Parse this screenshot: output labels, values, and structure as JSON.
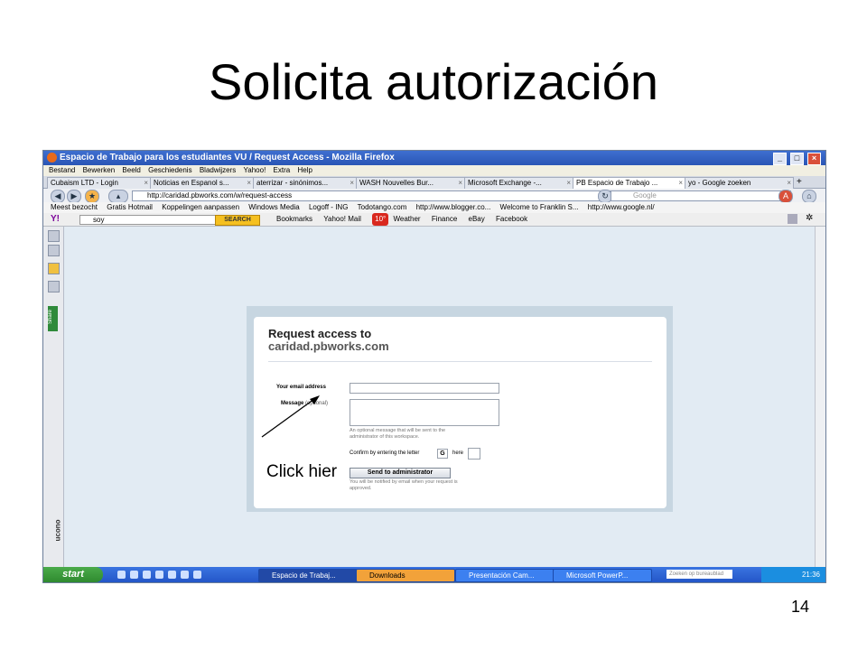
{
  "slide": {
    "title": "Solicita autorización",
    "annotation": "Click hier",
    "page_number": "14"
  },
  "browser": {
    "window_title": "Espacio de Trabajo para los estudiantes VU / Request Access - Mozilla Firefox",
    "menu": [
      "Bestand",
      "Bewerken",
      "Beeld",
      "Geschiedenis",
      "Bladwijzers",
      "Yahoo!",
      "Extra",
      "Help"
    ],
    "tabs": [
      {
        "label": "Cubaism LTD - Login",
        "active": false
      },
      {
        "label": "Noticias en Espanol s...",
        "active": false
      },
      {
        "label": "aterrizar - sinónimos...",
        "active": false
      },
      {
        "label": "WASH Nouvelles Bur...",
        "active": false
      },
      {
        "label": "Microsoft Exchange -...",
        "active": false
      },
      {
        "label": "PB Espacio de Trabajo ...",
        "active": true
      },
      {
        "label": "yo - Google zoeken",
        "active": false
      }
    ],
    "url": "http://caridad.pbworks.com/w/request-access",
    "search_placeholder": "Google",
    "bookmarks": [
      "Meest bezocht",
      "Gratis Hotmail",
      "Koppelingen aanpassen",
      "Windows Media",
      "Logoff - ING",
      "Todotango.com",
      "http://www.blogger.co...",
      "Welcome to Franklin S...",
      "http://www.google.nl/"
    ],
    "yahoo": {
      "logo": "Y!",
      "search_value": "soy",
      "search_button": "SEARCH",
      "items": [
        "Bookmarks",
        "Yahoo! Mail",
        "Weather",
        "Finance",
        "eBay",
        "Facebook"
      ],
      "weather_badge": "10°"
    },
    "sidebar_label": "Share",
    "sidebar_bottom": "ucono"
  },
  "form": {
    "heading_line1": "Request access to",
    "heading_line2": "caridad.pbworks.com",
    "email_label": "Your email address",
    "message_label": "Message",
    "message_optional": "(optional)",
    "message_hint_1": "An optional message that will be sent to the",
    "message_hint_2": "administrator of this workspace.",
    "confirm_label": "Confirm by entering the letter",
    "confirm_letter": "G",
    "confirm_here": "here",
    "send_button": "Send to administrator",
    "send_hint_1": "You will be notified by email when your request is",
    "send_hint_2": "approved."
  },
  "taskbar": {
    "start_label": "start",
    "tasks": [
      {
        "label": "Espacio de Trabaj...",
        "active": true
      },
      {
        "label": "Downloads",
        "active": false
      },
      {
        "label": "Presentación Cam...",
        "active": false
      },
      {
        "label": "Microsoft PowerP...",
        "active": false
      }
    ],
    "search_placeholder": "Zoeken op bureaublad",
    "clock": "21:36"
  },
  "colors": {
    "titlebar": "#2a55b5",
    "content_bg": "#e2ebf3",
    "taskbar": "#2456c8",
    "start": "#3a9a3a"
  }
}
